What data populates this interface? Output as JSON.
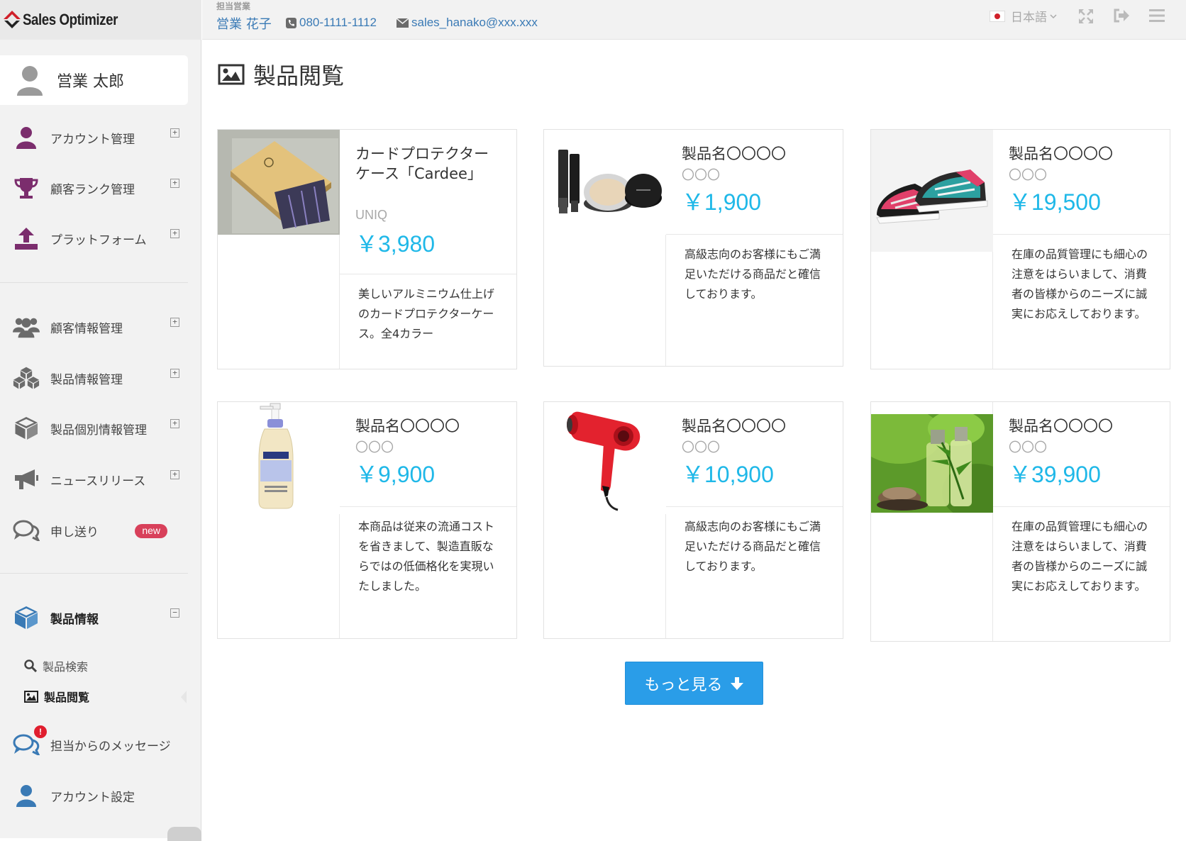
{
  "app": {
    "logo_text": "Sales Optimizer"
  },
  "sidebar": {
    "user_name": "営業 太郎",
    "groups": [
      {
        "label": "アカウント管理",
        "icon": "user-icon",
        "expander": "+"
      },
      {
        "label": "顧客ランク管理",
        "icon": "trophy-icon",
        "expander": "+"
      },
      {
        "label": "プラットフォーム",
        "icon": "upload-icon",
        "expander": "+"
      },
      {
        "label": "顧客情報管理",
        "icon": "users-icon",
        "expander": "+"
      },
      {
        "label": "製品情報管理",
        "icon": "cubes-icon",
        "expander": "+"
      },
      {
        "label": "製品個別情報管理",
        "icon": "cube-icon",
        "expander": "+"
      },
      {
        "label": "ニュースリリース",
        "icon": "megaphone-icon",
        "expander": "+"
      },
      {
        "label": "申し送り",
        "icon": "chat-icon",
        "badge": "new"
      },
      {
        "label": "製品情報",
        "icon": "cube-icon",
        "expander": "−"
      }
    ],
    "sub_items": [
      {
        "label": "製品検索",
        "icon": "search-icon"
      },
      {
        "label": "製品閲覧",
        "icon": "image-icon",
        "active": true
      }
    ],
    "bottom_items": [
      {
        "label": "担当からのメッセージ",
        "icon": "chat-icon",
        "alert": "!"
      },
      {
        "label": "アカウント設定",
        "icon": "user-icon"
      }
    ]
  },
  "header": {
    "rep_label": "担当営業",
    "rep_name": "営業 花子",
    "phone": "080-1111-1112",
    "email": "sales_hanako@xxx.xxx",
    "language": "日本語"
  },
  "main": {
    "title": "製品閲覧",
    "products": [
      {
        "name": "カードプロテクターケース「Cardee」",
        "brand": "UNIQ",
        "price": "￥3,980",
        "description": "美しいアルミニウム仕上げのカードプロテクターケース。全4カラー",
        "image": "card-case-photo"
      },
      {
        "name": "製品名〇〇〇〇",
        "brand": "〇〇〇",
        "price": "￥1,900",
        "description": "高級志向のお客様にもご満足いただける商品だと確信しております。",
        "image": "cosmetics-photo"
      },
      {
        "name": "製品名〇〇〇〇",
        "brand": "〇〇〇",
        "price": "￥19,500",
        "description": "在庫の品質管理にも細心の注意をはらいまして、消費者の皆様からのニーズに誠実にお応えしております。",
        "image": "sneakers-photo"
      },
      {
        "name": "製品名〇〇〇〇",
        "brand": "〇〇〇",
        "price": "￥9,900",
        "description": "本商品は従来の流通コストを省きまして、製造直販ならではの低価格化を実現いたしました。",
        "image": "lotion-photo"
      },
      {
        "name": "製品名〇〇〇〇",
        "brand": "〇〇〇",
        "price": "￥10,900",
        "description": "高級志向のお客様にもご満足いただける商品だと確信しております。",
        "image": "hair-dryer-photo"
      },
      {
        "name": "製品名〇〇〇〇",
        "brand": "〇〇〇",
        "price": "￥39,900",
        "description": "在庫の品質管理にも細心の注意をはらいまして、消費者の皆様からのニーズに誠実にお応えしております。",
        "image": "green-bottles-photo"
      }
    ],
    "more_button": "もっと見る"
  },
  "colors": {
    "accent": "#2a9de8",
    "price": "#1fb8e8",
    "link": "#3a7ab5",
    "nav_icon": "#7b2d6d",
    "badge": "#d8405a"
  }
}
